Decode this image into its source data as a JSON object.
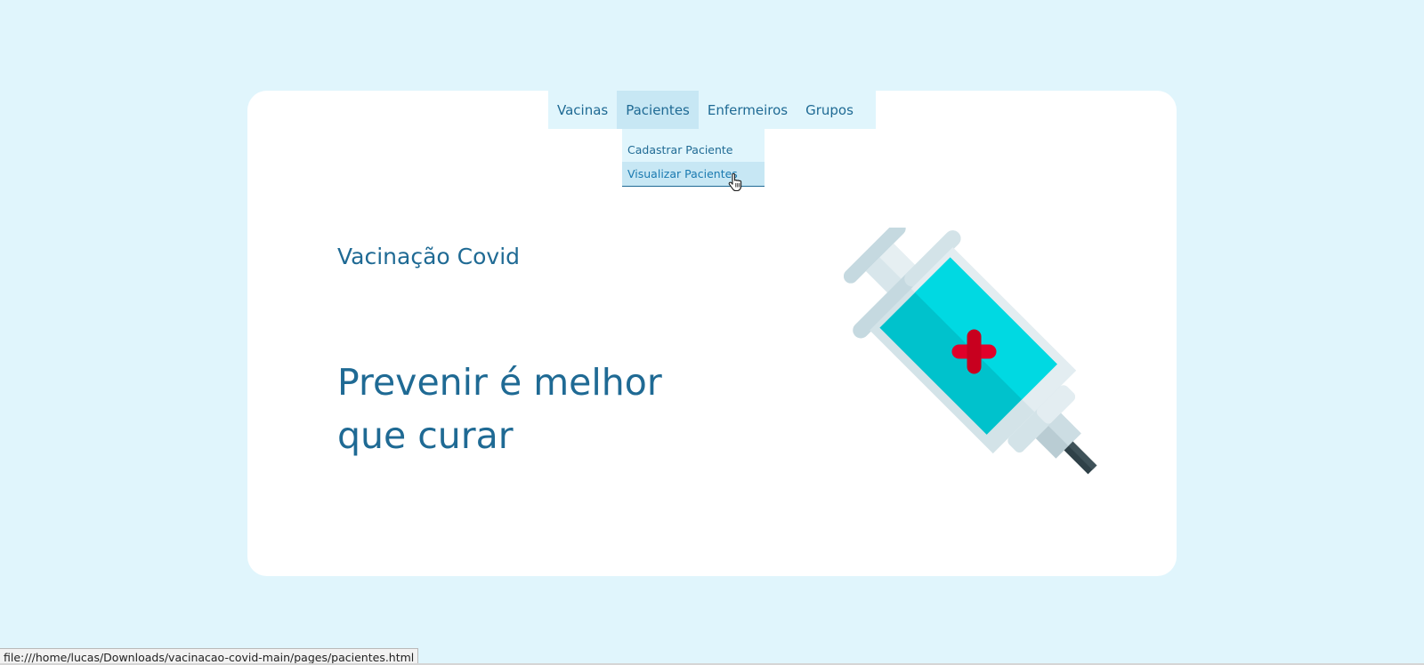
{
  "nav": {
    "items": [
      {
        "label": "Vacinas",
        "active": false
      },
      {
        "label": "Pacientes",
        "active": true
      },
      {
        "label": "Enfermeiros",
        "active": false
      },
      {
        "label": "Grupos",
        "active": false
      }
    ]
  },
  "dropdown": {
    "items": [
      {
        "label": "Cadastrar Paciente"
      },
      {
        "label": "Visualizar Pacientes"
      }
    ]
  },
  "hero": {
    "subtitle": "Vacinação Covid",
    "headline": "Prevenir é melhor que curar"
  },
  "status_bar": {
    "url": "file:///home/lucas/Downloads/vacinacao-covid-main/pages/pacientes.html"
  },
  "colors": {
    "background": "#e0f5fc",
    "card": "#ffffff",
    "text": "#1f6a94",
    "nav_active": "#c7e7f4",
    "syringe_body": "#00d5df",
    "cross": "#e5002b"
  },
  "icons": {
    "illustration": "syringe-icon",
    "cursor": "hand-pointer-icon"
  }
}
